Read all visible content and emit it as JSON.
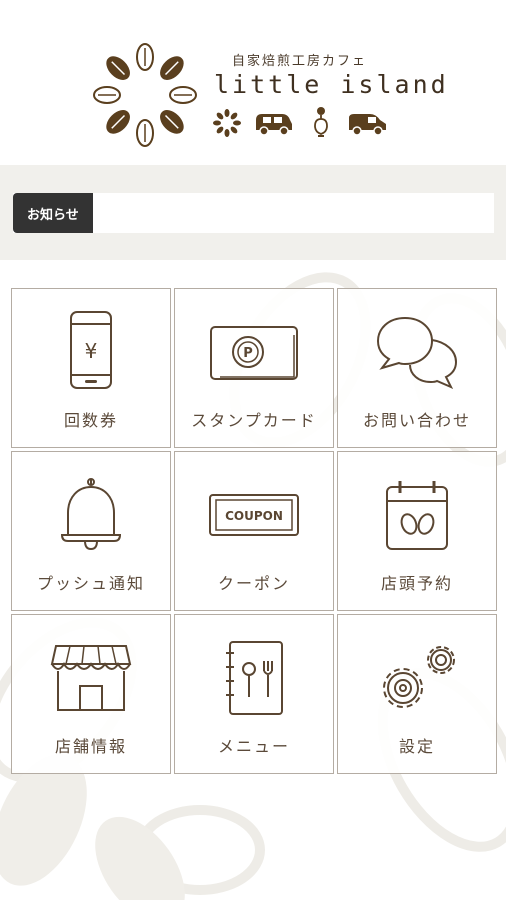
{
  "brand": {
    "subtitle": "自家焙煎工房カフェ",
    "name": "little island",
    "brown": "#5a3f1e"
  },
  "notice": {
    "label": "お知らせ"
  },
  "menu": {
    "items": [
      {
        "label": "回数券",
        "icon": "smartphone-yen-icon"
      },
      {
        "label": "スタンプカード",
        "icon": "stamp-card-icon"
      },
      {
        "label": "お問い合わせ",
        "icon": "speech-bubbles-icon"
      },
      {
        "label": "プッシュ通知",
        "icon": "bell-icon"
      },
      {
        "label": "クーポン",
        "icon": "coupon-ticket-icon"
      },
      {
        "label": "店頭予約",
        "icon": "calendar-icon"
      },
      {
        "label": "店舗情報",
        "icon": "storefront-icon"
      },
      {
        "label": "メニュー",
        "icon": "menu-book-icon"
      },
      {
        "label": "設定",
        "icon": "gears-icon"
      }
    ],
    "coupon_text": "COUPON",
    "yen_symbol": "¥",
    "stamp_symbol": "P"
  },
  "colors": {
    "icon": "#5a4632",
    "tile_border": "#b4aca3",
    "notice_label_bg": "#333333"
  }
}
